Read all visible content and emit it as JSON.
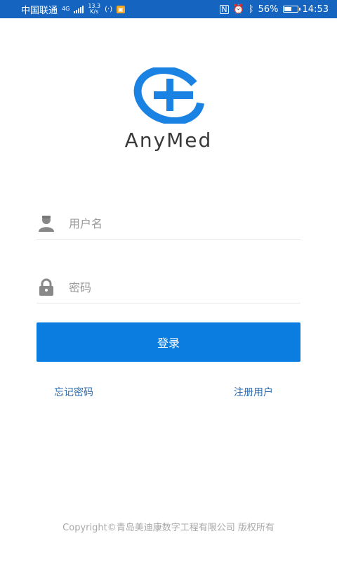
{
  "status_bar": {
    "carrier": "中国联通",
    "network_type": "4G",
    "speed_value": "13.3",
    "speed_unit": "K/s",
    "battery_percent": "56%",
    "battery_level": 0.56,
    "time": "14:53",
    "icons": [
      "signal-icon",
      "hotspot-icon",
      "notification-badge-icon",
      "nfc-icon",
      "alarm-icon",
      "bluetooth-icon",
      "battery-icon"
    ]
  },
  "app": {
    "brand_name": "AnyMed",
    "logo_color": "#1a82e2"
  },
  "login_form": {
    "username_placeholder": "用户名",
    "password_placeholder": "密码",
    "login_label": "登录",
    "accent_color": "#0b7de0"
  },
  "links": {
    "forgot_password": "忘记密码",
    "register": "注册用户"
  },
  "footer": {
    "copyright": "Copyright©青岛美迪康数字工程有限公司 版权所有"
  }
}
